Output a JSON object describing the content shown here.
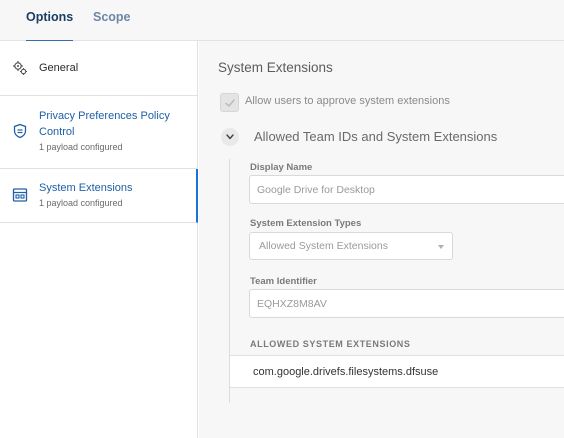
{
  "tabs": [
    {
      "label": "Options",
      "active": true
    },
    {
      "label": "Scope",
      "active": false
    }
  ],
  "sidebar": {
    "items": [
      {
        "label": "General",
        "sub": "",
        "icon": "gears-icon"
      },
      {
        "label": "Privacy Preferences Policy Control",
        "label_line1": "Privacy Preferences Policy",
        "label_line2": "Control",
        "sub": "1 payload configured",
        "icon": "shield-icon"
      },
      {
        "label": "System Extensions",
        "sub": "1 payload configured",
        "icon": "extensions-icon",
        "selected": true
      }
    ]
  },
  "main": {
    "section_title": "System Extensions",
    "allow_users_label": "Allow users to approve system extensions",
    "allow_users_checked": true,
    "group_title": "Allowed Team IDs and System Extensions",
    "display_name_label": "Display Name",
    "display_name_value": "Google Drive for Desktop",
    "types_label": "System Extension Types",
    "types_value": "Allowed System Extensions",
    "team_label": "Team Identifier",
    "team_value": "EQHXZ8M8AV",
    "list_header": "ALLOWED SYSTEM EXTENSIONS",
    "extensions": [
      "com.google.drivefs.filesystems.dfsuse"
    ]
  },
  "colors": {
    "accent": "#1a73d8",
    "selected_text": "#1f5fa8",
    "tab_active": "#1b3d66"
  }
}
